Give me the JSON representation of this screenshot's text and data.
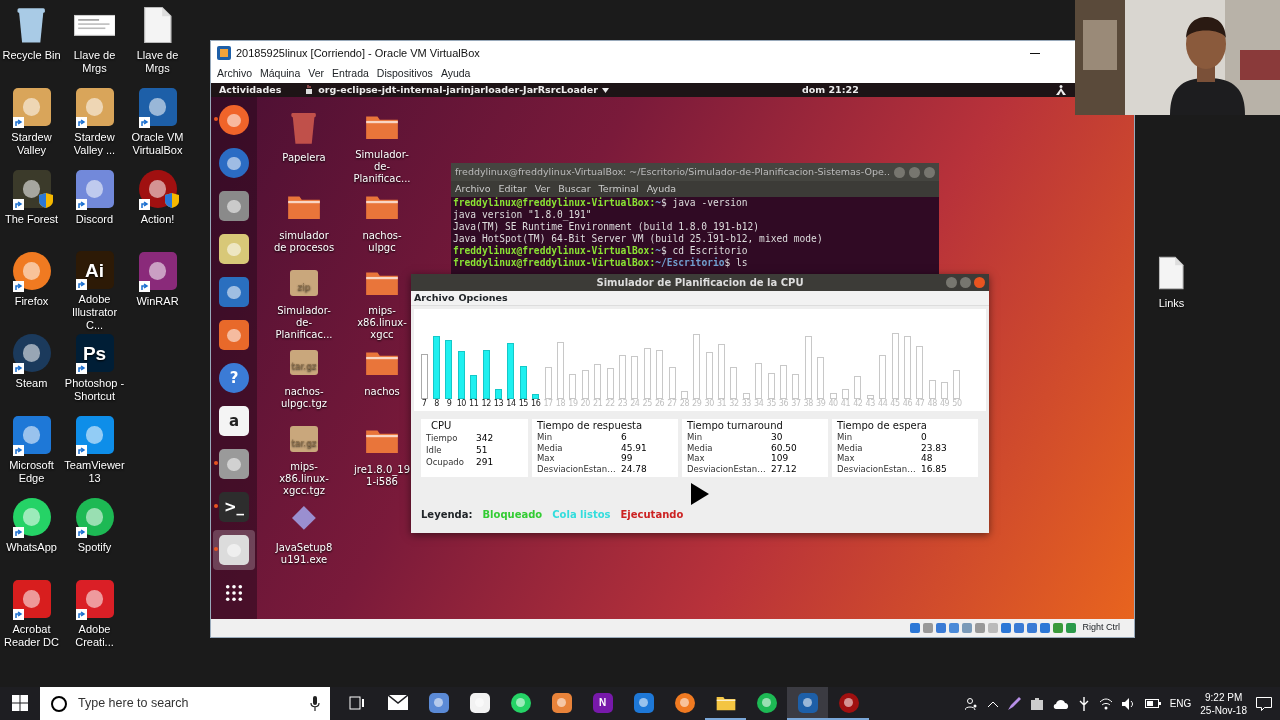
{
  "desktop_icons": [
    {
      "label": "Recycle Bin",
      "kind": "trash",
      "color": "#a9cbe6",
      "shortcut": false,
      "shield": false
    },
    {
      "label": "Stardew Valley",
      "kind": "tile",
      "color": "#d9a55a",
      "shortcut": true,
      "shield": false
    },
    {
      "label": "The Forest",
      "kind": "tile",
      "color": "#3b3a2a",
      "shortcut": true,
      "shield": true
    },
    {
      "label": "Firefox",
      "kind": "round",
      "color": "#f07a21",
      "shortcut": true,
      "shield": false
    },
    {
      "label": "Steam",
      "kind": "round",
      "color": "#1b3a5c",
      "shortcut": true,
      "shield": false
    },
    {
      "label": "Microsoft Edge",
      "kind": "tile",
      "color": "#1e78d7",
      "shortcut": true,
      "shield": false
    },
    {
      "label": "WhatsApp",
      "kind": "round",
      "color": "#25d366",
      "shortcut": true,
      "shield": false
    },
    {
      "label": "Acrobat Reader DC",
      "kind": "tile",
      "color": "#d81e1e",
      "shortcut": true,
      "shield": false
    },
    {
      "label": "Llave de Mrgs",
      "kind": "thumbnail",
      "color": "#ffffff",
      "shortcut": false,
      "shield": false
    },
    {
      "label": "Stardew Valley ...",
      "kind": "tile",
      "color": "#d9a55a",
      "shortcut": true,
      "shield": false
    },
    {
      "label": "Discord",
      "kind": "tile",
      "color": "#7289da",
      "shortcut": true,
      "shield": false
    },
    {
      "label": "Adobe Illustrator C...",
      "kind": "tile",
      "color": "#2d1a06",
      "glyph": "Ai",
      "shortcut": true,
      "shield": false
    },
    {
      "label": "Photoshop - Shortcut",
      "kind": "tile",
      "color": "#001e36",
      "glyph": "Ps",
      "shortcut": true,
      "shield": false
    },
    {
      "label": "TeamViewer 13",
      "kind": "tile",
      "color": "#0e8ee9",
      "shortcut": true,
      "shield": false
    },
    {
      "label": "Spotify",
      "kind": "round",
      "color": "#1db954",
      "shortcut": true,
      "shield": false
    },
    {
      "label": "Adobe Creati...",
      "kind": "tile",
      "color": "#da1f26",
      "shortcut": true,
      "shield": false
    },
    {
      "label": "Llave de Mrgs",
      "kind": "document",
      "color": "#f4f4f4",
      "shortcut": false,
      "shield": false
    },
    {
      "label": "Oracle VM VirtualBox",
      "kind": "tile",
      "color": "#1d5fa8",
      "shortcut": true,
      "shield": false
    },
    {
      "label": "Action!",
      "kind": "round",
      "color": "#a01010",
      "shortcut": true,
      "shield": true
    },
    {
      "label": "WinRAR",
      "kind": "tile",
      "color": "#8a2a7a",
      "shortcut": true,
      "shield": false
    }
  ],
  "right_desktop_icons": [
    {
      "label": "Links",
      "kind": "document",
      "color": "#f4f4f4",
      "shortcut": false,
      "shield": false
    }
  ],
  "virtualbox": {
    "title": "20185925linux [Corriendo] - Oracle VM VirtualBox",
    "menu": [
      "Archivo",
      "Máquina",
      "Ver",
      "Entrada",
      "Dispositivos",
      "Ayuda"
    ],
    "status_text": "Right Ctrl"
  },
  "ubuntu": {
    "top_bar": {
      "activities": "Actividades",
      "app_menu": "org-eclipse-jdt-internal-jarinjarloader-JarRsrcLoader",
      "clock": "dom 21:22"
    },
    "dock": [
      {
        "kind": "round",
        "color": "#f0642a",
        "running": true,
        "selected": false
      },
      {
        "kind": "round",
        "color": "#2b6cc4",
        "running": false,
        "selected": false
      },
      {
        "kind": "tile",
        "color": "#8a8a8a",
        "running": false,
        "selected": false
      },
      {
        "kind": "tile",
        "color": "#d8c878",
        "running": false,
        "selected": false
      },
      {
        "kind": "tile",
        "color": "#2a6fbf",
        "running": false,
        "selected": false
      },
      {
        "kind": "tile",
        "color": "#e8692a",
        "running": false,
        "selected": false
      },
      {
        "kind": "round",
        "color": "#3b7bd6",
        "glyph": "?",
        "running": false,
        "selected": false
      },
      {
        "kind": "tile",
        "color": "#f4f4f4",
        "glyph": "a",
        "running": false,
        "selected": false
      },
      {
        "kind": "tile",
        "color": "#9a9a9a",
        "running": true,
        "selected": false
      },
      {
        "kind": "tile",
        "color": "#2d2d2d",
        "glyph": ">_",
        "running": true,
        "selected": false
      },
      {
        "kind": "tile",
        "color": "#dcdcdc",
        "running": true,
        "selected": true
      },
      {
        "kind": "dots",
        "color": "#ffffff",
        "running": false,
        "selected": false
      }
    ],
    "desktop_icons": [
      {
        "label": "Papelera",
        "kind": "trash",
        "color": "#c0504a"
      },
      {
        "label": "simulador de procesos",
        "kind": "folder",
        "color": "#e9753a"
      },
      {
        "label": "Simulador-de-Planificac...",
        "kind": "package",
        "color": "#c9a77c",
        "glyph": "zip"
      },
      {
        "label": "nachos-ulpgc.tgz",
        "kind": "package",
        "color": "#c9a77c",
        "glyph": "tar.gz"
      },
      {
        "label": "mips-x86.linux-xgcc.tgz",
        "kind": "package",
        "color": "#c9a77c",
        "glyph": "tar.gz"
      },
      {
        "label": "JavaSetup8u191.exe",
        "kind": "diamond",
        "color": "#9a8fd0"
      },
      {
        "label": "Simulador-de-Planificac...",
        "kind": "folder",
        "color": "#e9753a"
      },
      {
        "label": "nachos-ulpgc",
        "kind": "folder",
        "color": "#e9753a"
      },
      {
        "label": "mips-x86.linux-xgcc",
        "kind": "folder",
        "color": "#e9753a"
      },
      {
        "label": "nachos",
        "kind": "folder",
        "color": "#e9753a"
      },
      {
        "label": "jre1.8.0_191-i586",
        "kind": "folder",
        "color": "#e9753a"
      }
    ],
    "terminal": {
      "title": "freddylinux@freddylinux-VirtualBox: ~/Escritorio/Simulador-de-Planificacion-Sistemas-Ope…",
      "menu": [
        "Archivo",
        "Editar",
        "Ver",
        "Buscar",
        "Terminal",
        "Ayuda"
      ],
      "lines": [
        {
          "kind": "prompt",
          "user": "freddylinux@freddylinux-VirtualBox:",
          "path": "~",
          "command": "$ java -version"
        },
        {
          "kind": "output",
          "text": "java version \"1.8.0_191\""
        },
        {
          "kind": "output",
          "text": "Java(TM) SE Runtime Environment (build 1.8.0_191-b12)"
        },
        {
          "kind": "output",
          "text": "Java HotSpot(TM) 64-Bit Server VM (build 25.191-b12, mixed mode)"
        },
        {
          "kind": "prompt",
          "user": "freddylinux@freddylinux-VirtualBox:",
          "path": "~",
          "command": "$ cd Escritorio"
        },
        {
          "kind": "prompt",
          "user": "freddylinux@freddylinux-VirtualBox:",
          "path": "~/Escritorio",
          "command": "$ ls"
        }
      ]
    },
    "simulator": {
      "title": "Simulador de Planificacion de la CPU",
      "menu": [
        "Archivo",
        "Opciones"
      ],
      "processes": [
        {
          "label": "7",
          "kind": "done"
        },
        {
          "label": "8",
          "kind": "ready"
        },
        {
          "label": "9",
          "kind": "ready"
        },
        {
          "label": "10",
          "kind": "ready"
        },
        {
          "label": "11",
          "kind": "ready"
        },
        {
          "label": "12",
          "kind": "ready"
        },
        {
          "label": "13",
          "kind": "ready"
        },
        {
          "label": "14",
          "kind": "ready"
        },
        {
          "label": "15",
          "kind": "ready"
        },
        {
          "label": "16",
          "kind": "ready"
        },
        {
          "label": "17",
          "kind": "pending"
        },
        {
          "label": "18",
          "kind": "pending"
        },
        {
          "label": "19",
          "kind": "pending"
        },
        {
          "label": "20",
          "kind": "pending"
        },
        {
          "label": "21",
          "kind": "pending"
        },
        {
          "label": "22",
          "kind": "pending"
        },
        {
          "label": "23",
          "kind": "pending"
        },
        {
          "label": "24",
          "kind": "pending"
        },
        {
          "label": "25",
          "kind": "pending"
        },
        {
          "label": "26",
          "kind": "pending"
        },
        {
          "label": "27",
          "kind": "pending"
        },
        {
          "label": "28",
          "kind": "pending"
        },
        {
          "label": "29",
          "kind": "pending"
        },
        {
          "label": "30",
          "kind": "pending"
        },
        {
          "label": "31",
          "kind": "pending"
        },
        {
          "label": "32",
          "kind": "pending"
        },
        {
          "label": "33",
          "kind": "pending"
        },
        {
          "label": "34",
          "kind": "pending"
        },
        {
          "label": "35",
          "kind": "pending"
        },
        {
          "label": "36",
          "kind": "pending"
        },
        {
          "label": "37",
          "kind": "pending"
        },
        {
          "label": "38",
          "kind": "pending"
        },
        {
          "label": "39",
          "kind": "pending"
        },
        {
          "label": "40",
          "kind": "pending"
        },
        {
          "label": "41",
          "kind": "pending"
        },
        {
          "label": "42",
          "kind": "pending"
        },
        {
          "label": "43",
          "kind": "pending"
        },
        {
          "label": "44",
          "kind": "pending"
        },
        {
          "label": "45",
          "kind": "pending"
        },
        {
          "label": "46",
          "kind": "pending"
        },
        {
          "label": "47",
          "kind": "pending"
        },
        {
          "label": "48",
          "kind": "pending"
        },
        {
          "label": "49",
          "kind": "pending"
        },
        {
          "label": "50",
          "kind": "pending"
        }
      ],
      "stats": [
        {
          "title": "CPU",
          "rows": [
            {
              "label": "Tiempo",
              "value": "342"
            },
            {
              "label": "Idle",
              "value": "51"
            },
            {
              "label": "Ocupado",
              "value": "291"
            }
          ]
        },
        {
          "title": "Tiempo de respuesta",
          "rows": [
            {
              "label": "Min",
              "value": "6"
            },
            {
              "label": "Media",
              "value": "45.91"
            },
            {
              "label": "Max",
              "value": "99"
            },
            {
              "label": "DesviacionEstan…",
              "value": "24.78"
            }
          ]
        },
        {
          "title": "Tiempo turnaround",
          "rows": [
            {
              "label": "Min",
              "value": "30"
            },
            {
              "label": "Media",
              "value": "60.50"
            },
            {
              "label": "Max",
              "value": "109"
            },
            {
              "label": "DesviacionEstan…",
              "value": "27.12"
            }
          ]
        },
        {
          "title": "Tiempo de espera",
          "rows": [
            {
              "label": "Min",
              "value": "0"
            },
            {
              "label": "Media",
              "value": "23.83"
            },
            {
              "label": "Max",
              "value": "48"
            },
            {
              "label": "DesviacionEstan…",
              "value": "16.85"
            }
          ]
        }
      ],
      "legend": {
        "title": "Leyenda:",
        "items": [
          {
            "label": "Bloqueado",
            "color": "#33cc33"
          },
          {
            "label": "Cola listos",
            "color": "#33dddd"
          },
          {
            "label": "Ejecutando",
            "color": "#cc2222"
          }
        ]
      }
    }
  },
  "taskbar": {
    "search_placeholder": "Type here to search",
    "apps": [
      {
        "kind": "envelope",
        "color": "#ffffff",
        "open": false,
        "selected": false
      },
      {
        "kind": "tile",
        "color": "#5b8ad6",
        "open": false,
        "selected": false
      },
      {
        "kind": "tile",
        "color": "#f2f2f2",
        "open": false,
        "selected": false
      },
      {
        "kind": "round",
        "color": "#25d366",
        "open": false,
        "selected": false
      },
      {
        "kind": "tile",
        "color": "#e8833a",
        "open": false,
        "selected": false
      },
      {
        "kind": "tile",
        "color": "#7719aa",
        "glyph": "N",
        "open": false,
        "selected": false
      },
      {
        "kind": "tile",
        "color": "#1e78d7",
        "open": false,
        "selected": false
      },
      {
        "kind": "round",
        "color": "#f07a21",
        "open": false,
        "selected": false
      },
      {
        "kind": "folder",
        "color": "#f4c542",
        "open": true,
        "selected": false
      },
      {
        "kind": "round",
        "color": "#1db954",
        "open": false,
        "selected": false
      },
      {
        "kind": "tile",
        "color": "#1d5fa8",
        "open": true,
        "selected": true
      },
      {
        "kind": "round",
        "color": "#a01010",
        "open": true,
        "selected": false
      }
    ],
    "language": "ENG",
    "time": "9:22 PM",
    "date": "25-Nov-18"
  }
}
